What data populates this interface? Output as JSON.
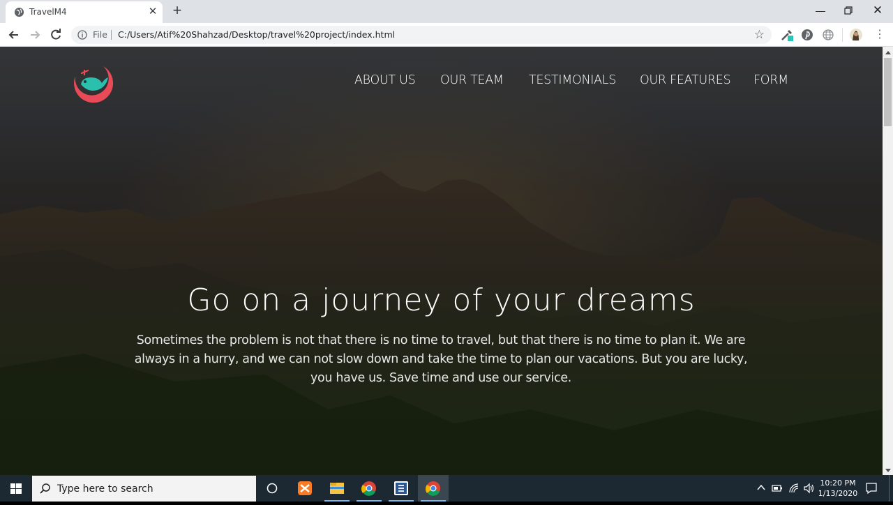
{
  "browser": {
    "tab_title": "TravelM4",
    "address_scheme": "File",
    "address_url": "C:/Users/Atif%20Shahzad/Desktop/travel%20project/index.html"
  },
  "page": {
    "nav": [
      "ABOUT US",
      "OUR TEAM",
      "TESTIMONIALS",
      "OUR FEATURES",
      "FORM"
    ],
    "hero_title": "Go on a journey of your dreams",
    "hero_text": "Sometimes the problem is not that there is no time to travel, but that there is no time to plan it. We are always in a hurry, and we can not slow down and take the time to plan our vacations. But you are lucky, you have us. Save time and use our service.",
    "colors": {
      "logo_red": "#e94a57",
      "logo_teal": "#2bbfad"
    }
  },
  "taskbar": {
    "search_placeholder": "Type here to search",
    "time": "10:20 PM",
    "date": "1/13/2020",
    "pinned": [
      "task-view-icon",
      "xampp-icon",
      "file-explorer-icon",
      "chrome-icon",
      "sublime-text-icon",
      "chrome-icon"
    ]
  }
}
